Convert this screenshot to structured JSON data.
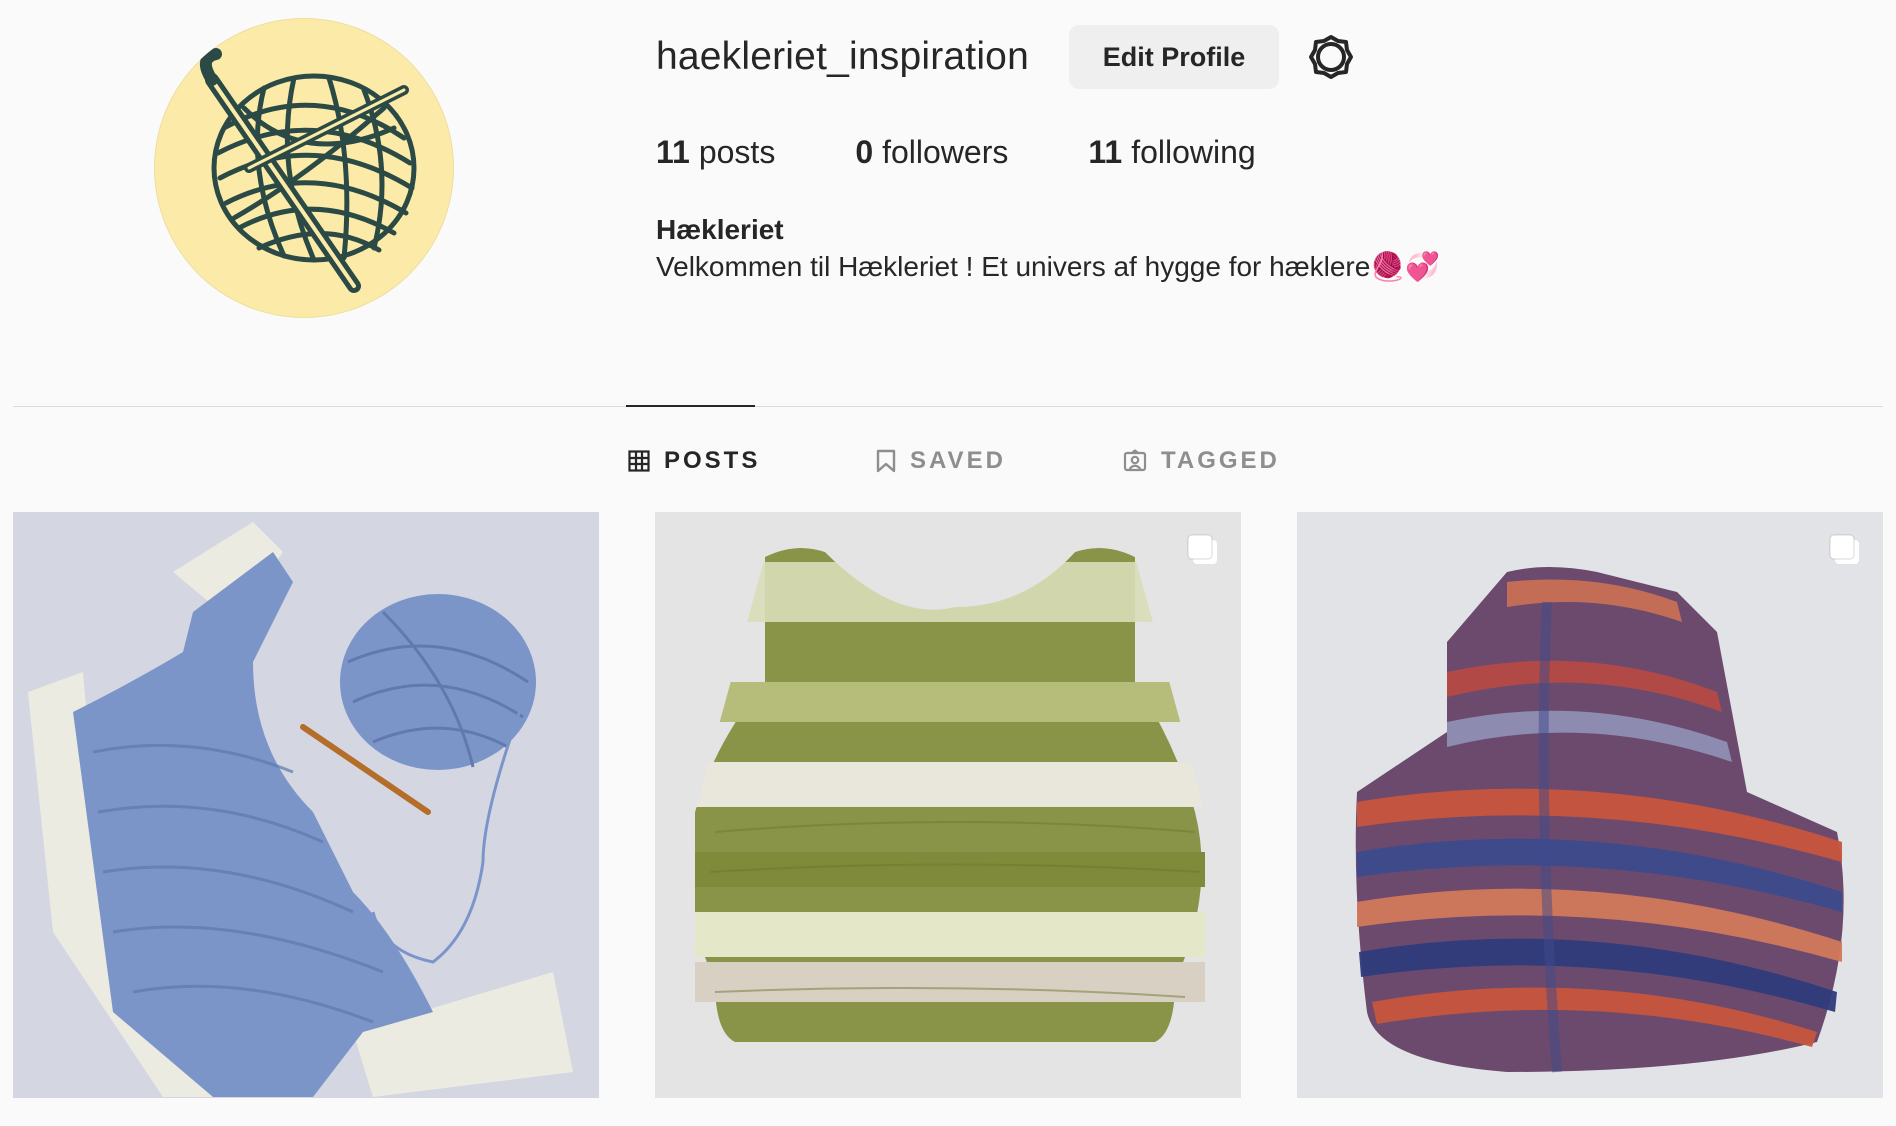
{
  "profile": {
    "username": "haekleriet_inspiration",
    "edit_profile_label": "Edit Profile",
    "stats": {
      "posts_count": "11",
      "posts_label": "posts",
      "followers_count": "0",
      "followers_label": "followers",
      "following_count": "11",
      "following_label": "following"
    },
    "full_name": "Hækleriet",
    "bio": "Velkommen til Hækleriet ! Et univers af hygge for hæklere🧶💞"
  },
  "tabs": [
    {
      "label": "POSTS",
      "icon": "grid-icon",
      "active": true
    },
    {
      "label": "SAVED",
      "icon": "bookmark-icon",
      "active": false
    },
    {
      "label": "TAGGED",
      "icon": "tagged-person-icon",
      "active": false
    }
  ],
  "posts": [
    {
      "subject": "blue crocheted top with cream ruffle edges, yarn ball and crochet hook",
      "multiple": false
    },
    {
      "subject": "green and cream striped crocheted vest",
      "multiple": true
    },
    {
      "subject": "multicolored red and blue striped crocheted vest",
      "multiple": true
    }
  ],
  "colors": {
    "background": "#fafafa",
    "avatar_background": "#fbeaa8",
    "logo_ink": "#2b4a46",
    "button_background": "#efefef",
    "text": "#262626",
    "muted_text": "#8e8e8e",
    "divider": "#dbdbdb"
  }
}
